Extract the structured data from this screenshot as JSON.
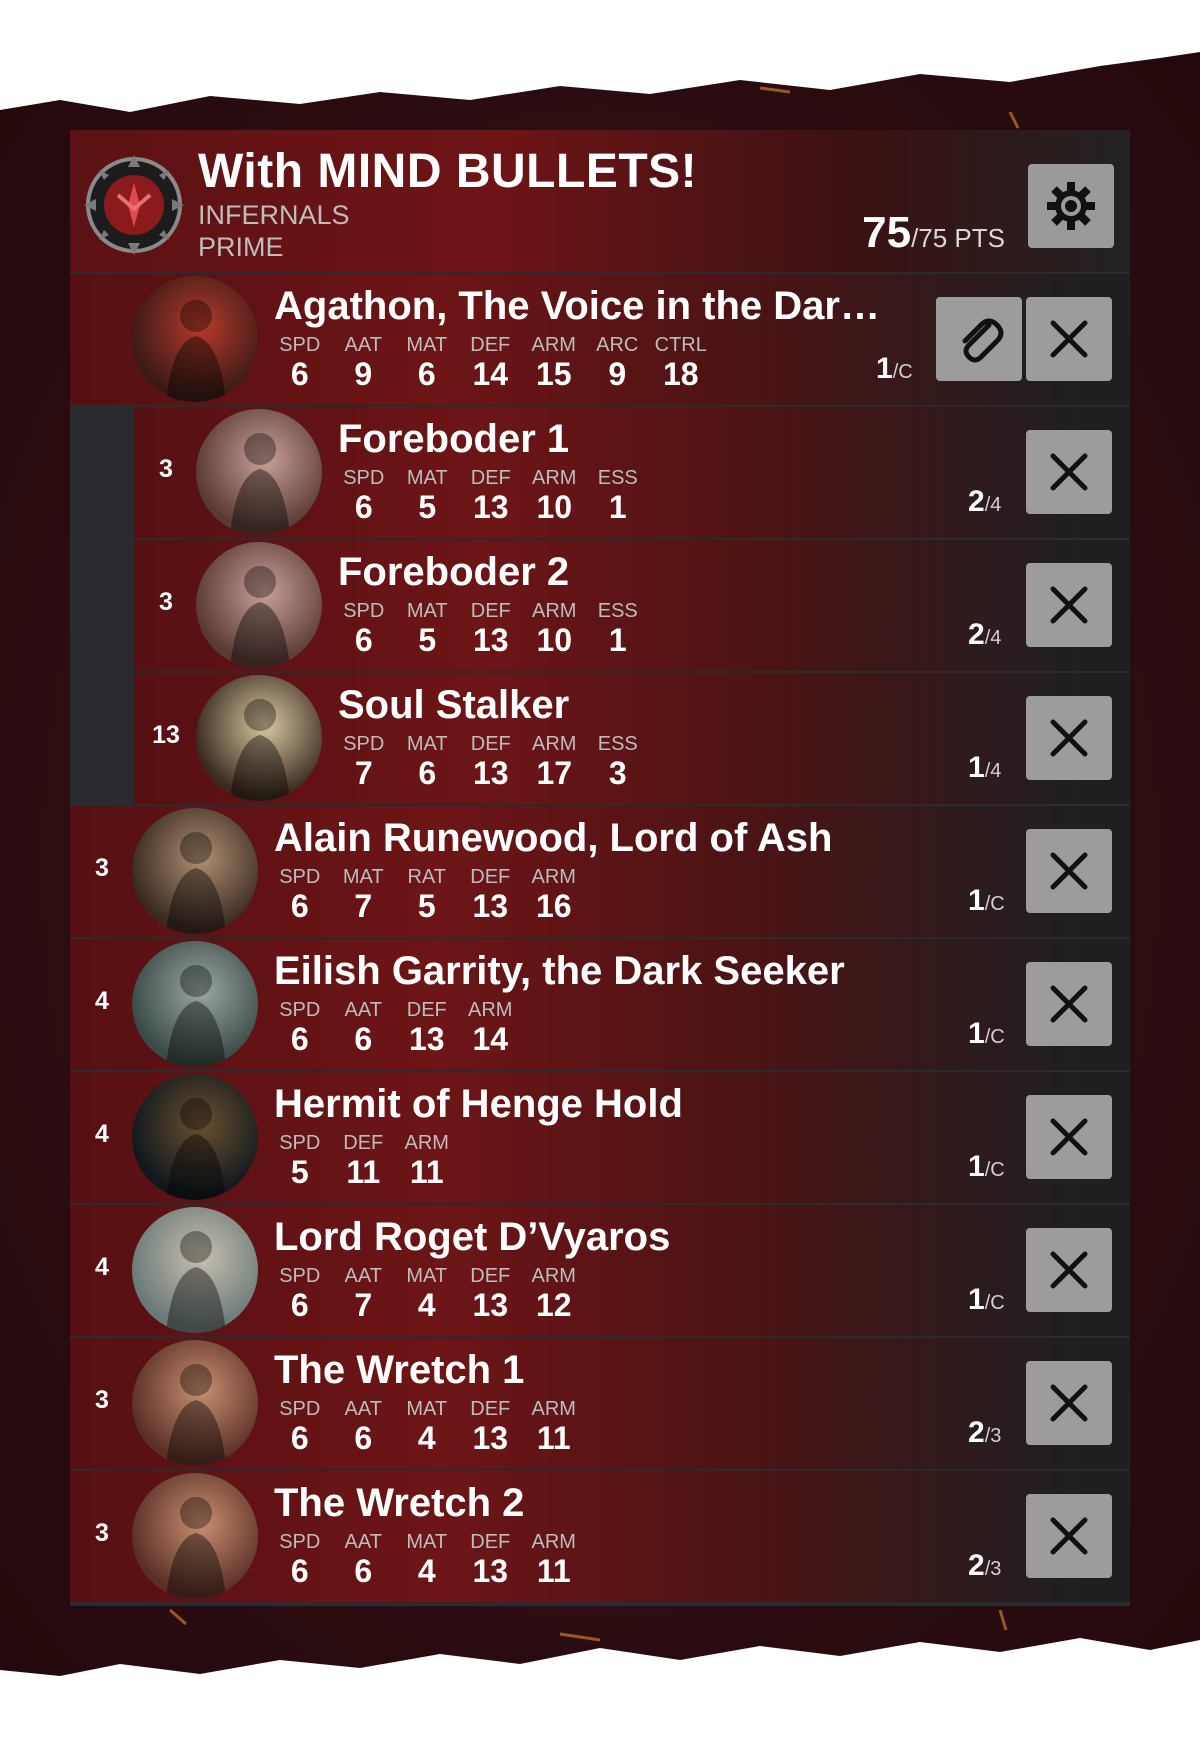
{
  "header": {
    "title": "With MIND BULLETS!",
    "faction": "INFERNALS",
    "caster_type": "PRIME",
    "points_used": "75",
    "points_total": "/75 PTS",
    "settings_icon": "gear-icon"
  },
  "colors": {
    "header_red": "#6e1416",
    "row_red": "#6d1517",
    "panel": "#2a2b2e",
    "button_gray": "#9c9c9c"
  },
  "units": [
    {
      "level": 0,
      "count": "",
      "name": "Agathon, The Voice in the Dar…",
      "stats": [
        [
          "SPD",
          "6"
        ],
        [
          "AAT",
          "9"
        ],
        [
          "MAT",
          "6"
        ],
        [
          "DEF",
          "14"
        ],
        [
          "ARM",
          "15"
        ],
        [
          "ARC",
          "9"
        ],
        [
          "CTRL",
          "18"
        ]
      ],
      "fa_num": "1",
      "fa_den": "/C",
      "attach": true
    },
    {
      "level": 1,
      "count": "3",
      "name": "Foreboder 1",
      "stats": [
        [
          "SPD",
          "6"
        ],
        [
          "MAT",
          "5"
        ],
        [
          "DEF",
          "13"
        ],
        [
          "ARM",
          "10"
        ],
        [
          "ESS",
          "1"
        ]
      ],
      "fa_num": "2",
      "fa_den": "/4",
      "attach": false
    },
    {
      "level": 1,
      "count": "3",
      "name": "Foreboder 2",
      "stats": [
        [
          "SPD",
          "6"
        ],
        [
          "MAT",
          "5"
        ],
        [
          "DEF",
          "13"
        ],
        [
          "ARM",
          "10"
        ],
        [
          "ESS",
          "1"
        ]
      ],
      "fa_num": "2",
      "fa_den": "/4",
      "attach": false
    },
    {
      "level": 1,
      "count": "13",
      "name": "Soul Stalker",
      "stats": [
        [
          "SPD",
          "7"
        ],
        [
          "MAT",
          "6"
        ],
        [
          "DEF",
          "13"
        ],
        [
          "ARM",
          "17"
        ],
        [
          "ESS",
          "3"
        ]
      ],
      "fa_num": "1",
      "fa_den": "/4",
      "attach": false
    },
    {
      "level": 0,
      "count": "3",
      "name": "Alain Runewood, Lord of Ash",
      "stats": [
        [
          "SPD",
          "6"
        ],
        [
          "MAT",
          "7"
        ],
        [
          "RAT",
          "5"
        ],
        [
          "DEF",
          "13"
        ],
        [
          "ARM",
          "16"
        ]
      ],
      "fa_num": "1",
      "fa_den": "/C",
      "attach": false
    },
    {
      "level": 0,
      "count": "4",
      "name": "Eilish Garrity, the Dark Seeker",
      "stats": [
        [
          "SPD",
          "6"
        ],
        [
          "AAT",
          "6"
        ],
        [
          "DEF",
          "13"
        ],
        [
          "ARM",
          "14"
        ]
      ],
      "fa_num": "1",
      "fa_den": "/C",
      "attach": false
    },
    {
      "level": 0,
      "count": "4",
      "name": "Hermit of Henge Hold",
      "stats": [
        [
          "SPD",
          "5"
        ],
        [
          "DEF",
          "11"
        ],
        [
          "ARM",
          "11"
        ]
      ],
      "fa_num": "1",
      "fa_den": "/C",
      "attach": false
    },
    {
      "level": 0,
      "count": "4",
      "name": "Lord Roget D’Vyaros",
      "stats": [
        [
          "SPD",
          "6"
        ],
        [
          "AAT",
          "7"
        ],
        [
          "MAT",
          "4"
        ],
        [
          "DEF",
          "13"
        ],
        [
          "ARM",
          "12"
        ]
      ],
      "fa_num": "1",
      "fa_den": "/C",
      "attach": false
    },
    {
      "level": 0,
      "count": "3",
      "name": "The Wretch 1",
      "stats": [
        [
          "SPD",
          "6"
        ],
        [
          "AAT",
          "6"
        ],
        [
          "MAT",
          "4"
        ],
        [
          "DEF",
          "13"
        ],
        [
          "ARM",
          "11"
        ]
      ],
      "fa_num": "2",
      "fa_den": "/3",
      "attach": false
    },
    {
      "level": 0,
      "count": "3",
      "name": "The Wretch 2",
      "stats": [
        [
          "SPD",
          "6"
        ],
        [
          "AAT",
          "6"
        ],
        [
          "MAT",
          "4"
        ],
        [
          "DEF",
          "13"
        ],
        [
          "ARM",
          "11"
        ]
      ],
      "fa_num": "2",
      "fa_den": "/3",
      "attach": false
    }
  ]
}
